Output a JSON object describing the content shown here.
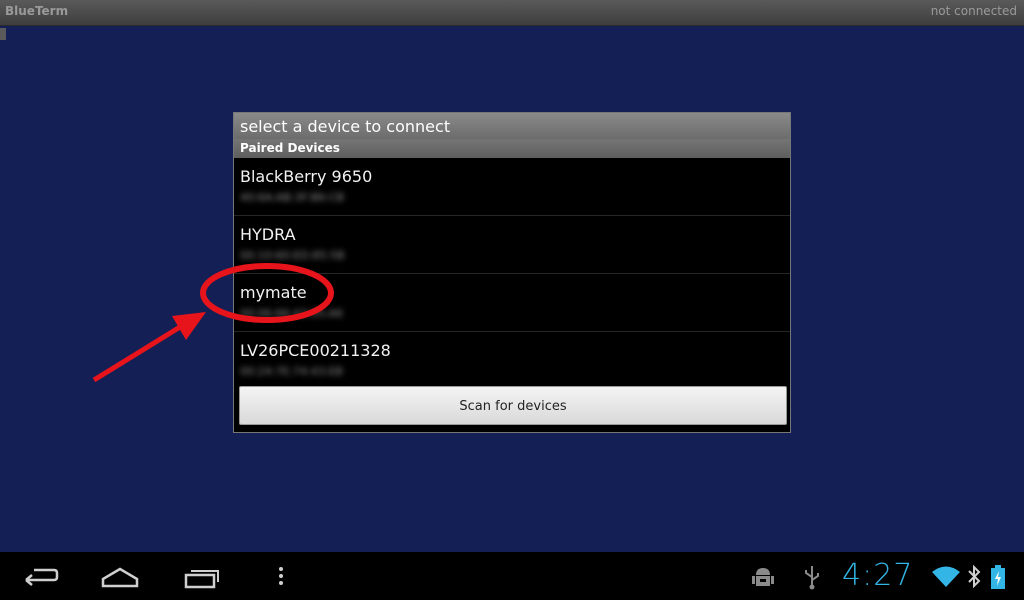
{
  "app": {
    "title": "BlueTerm",
    "connection_status": "not connected"
  },
  "dialog": {
    "title": "select a device to connect",
    "section_header": "Paired Devices",
    "devices": [
      {
        "name": "BlackBerry 9650",
        "address": "40:6A:AB:3F:B6:CB"
      },
      {
        "name": "HYDRA",
        "address": "00:10:60:ED:85:5B"
      },
      {
        "name": "mymate",
        "address": "00:06:66:43:05:A6"
      },
      {
        "name": "LV26PCE00211328",
        "address": "00:24:7E:74:43:EB"
      }
    ],
    "scan_button_label": "Scan for devices"
  },
  "annotation": {
    "color": "#e8141b",
    "highlighted_device": "mymate"
  },
  "status_bar": {
    "time": "4:27",
    "accent_color": "#33b5e5",
    "icons": [
      "android-debug-icon",
      "usb-icon",
      "wifi-icon",
      "bluetooth-icon",
      "battery-charging-icon"
    ]
  },
  "nav_bar": {
    "icons": [
      "back-icon",
      "home-icon",
      "recent-apps-icon",
      "menu-icon"
    ]
  }
}
